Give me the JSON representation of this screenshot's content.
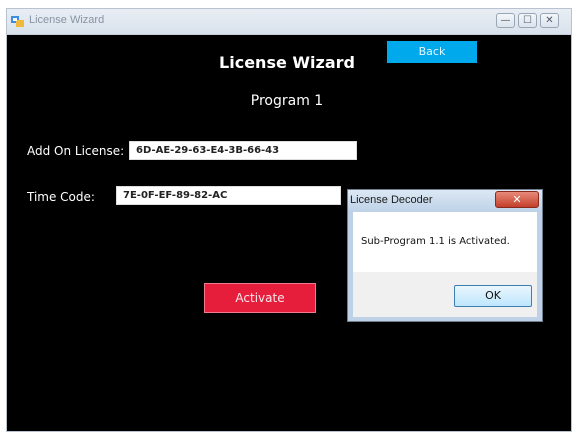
{
  "window": {
    "title": "License Wizard",
    "controls": {
      "minimize": "—",
      "maximize": "☐",
      "close": "✕"
    }
  },
  "main": {
    "back_label": "Back",
    "heading": "License Wizard",
    "subheading": "Program 1",
    "add_on_license_label": "Add On License:",
    "add_on_license_value": "6D-AE-29-63-E4-3B-66-43",
    "time_code_label": "Time Code:",
    "time_code_value": "7E-0F-EF-89-82-AC",
    "activate_label": "Activate"
  },
  "dialog": {
    "title": "License Decoder",
    "close": "✕",
    "message": "Sub-Program 1.1 is Activated.",
    "ok_label": "OK"
  },
  "colors": {
    "background": "#000000",
    "back_button": "#00a8ec",
    "activate_button": "#e61e3c"
  }
}
